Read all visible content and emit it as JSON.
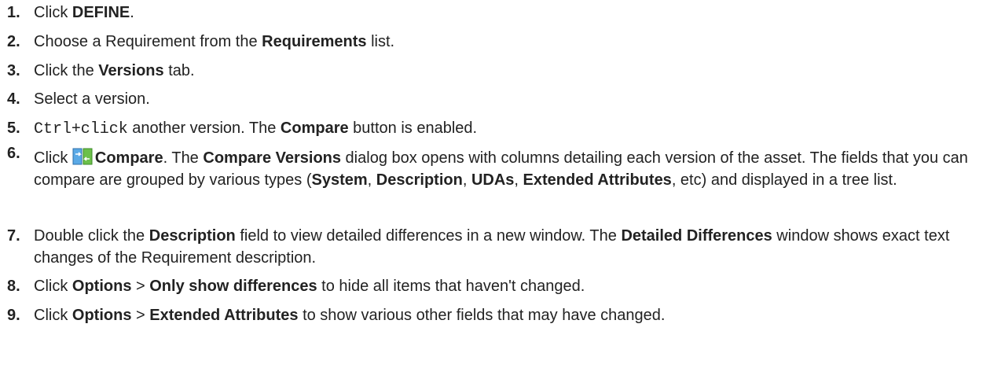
{
  "steps": [
    {
      "number": "1.",
      "parts": [
        {
          "t": "Click "
        },
        {
          "t": "DEFINE",
          "b": true
        },
        {
          "t": "."
        }
      ]
    },
    {
      "number": "2.",
      "parts": [
        {
          "t": "Choose a Requirement from the "
        },
        {
          "t": "Requirements",
          "b": true
        },
        {
          "t": " list."
        }
      ]
    },
    {
      "number": "3.",
      "parts": [
        {
          "t": "Click the "
        },
        {
          "t": "Versions",
          "b": true
        },
        {
          "t": " tab."
        }
      ]
    },
    {
      "number": "4.",
      "parts": [
        {
          "t": "Select a version."
        }
      ]
    },
    {
      "number": "5.",
      "parts": [
        {
          "t": "Ctrl",
          "m": true
        },
        {
          "t": "+"
        },
        {
          "t": "click",
          "m": true
        },
        {
          "t": " another version. The "
        },
        {
          "t": "Compare",
          "b": true
        },
        {
          "t": " button is enabled."
        }
      ]
    },
    {
      "number": "6.",
      "parts": [
        {
          "t": "Click "
        },
        {
          "icon": "compare-icon"
        },
        {
          "t": "Compare",
          "b": true
        },
        {
          "t": ". The "
        },
        {
          "t": "Compare Versions",
          "b": true
        },
        {
          "t": " dialog box opens with columns detailing each version of the asset. The fields that you can compare are grouped by various types ("
        },
        {
          "t": "System",
          "b": true
        },
        {
          "t": ", "
        },
        {
          "t": "Description",
          "b": true
        },
        {
          "t": ", "
        },
        {
          "t": "UDAs",
          "b": true
        },
        {
          "t": ", "
        },
        {
          "t": "Extended Attributes",
          "b": true
        },
        {
          "t": ", etc) and displayed in a tree list."
        }
      ]
    },
    {
      "number": "7.",
      "parts": [
        {
          "t": "Double click the "
        },
        {
          "t": "Description",
          "b": true
        },
        {
          "t": " field to view detailed differences in a new window. The "
        },
        {
          "t": "Detailed Differences",
          "b": true
        },
        {
          "t": " window shows exact text changes of the Requirement description."
        }
      ]
    },
    {
      "number": "8.",
      "parts": [
        {
          "t": "Click "
        },
        {
          "t": "Options",
          "b": true
        },
        {
          "t": " > "
        },
        {
          "t": "Only show differences",
          "b": true
        },
        {
          "t": " to hide all items that haven't changed."
        }
      ]
    },
    {
      "number": "9.",
      "parts": [
        {
          "t": "Click "
        },
        {
          "t": "Options",
          "b": true
        },
        {
          "t": " > "
        },
        {
          "t": "Extended Attributes",
          "b": true
        },
        {
          "t": " to show various other fields that may have changed."
        }
      ]
    }
  ]
}
